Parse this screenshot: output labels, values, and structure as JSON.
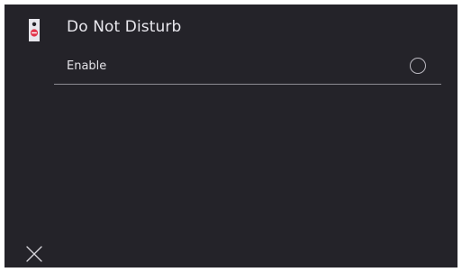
{
  "header": {
    "title": "Do Not Disturb",
    "icon": "door-hanger-sign-icon"
  },
  "setting": {
    "label": "Enable",
    "enabled": false
  },
  "footer": {
    "close_icon": "close-icon"
  },
  "colors": {
    "background": "#242329",
    "text": "#e9e8ee",
    "divider": "#8d8b93",
    "accent": "#e2334a"
  }
}
